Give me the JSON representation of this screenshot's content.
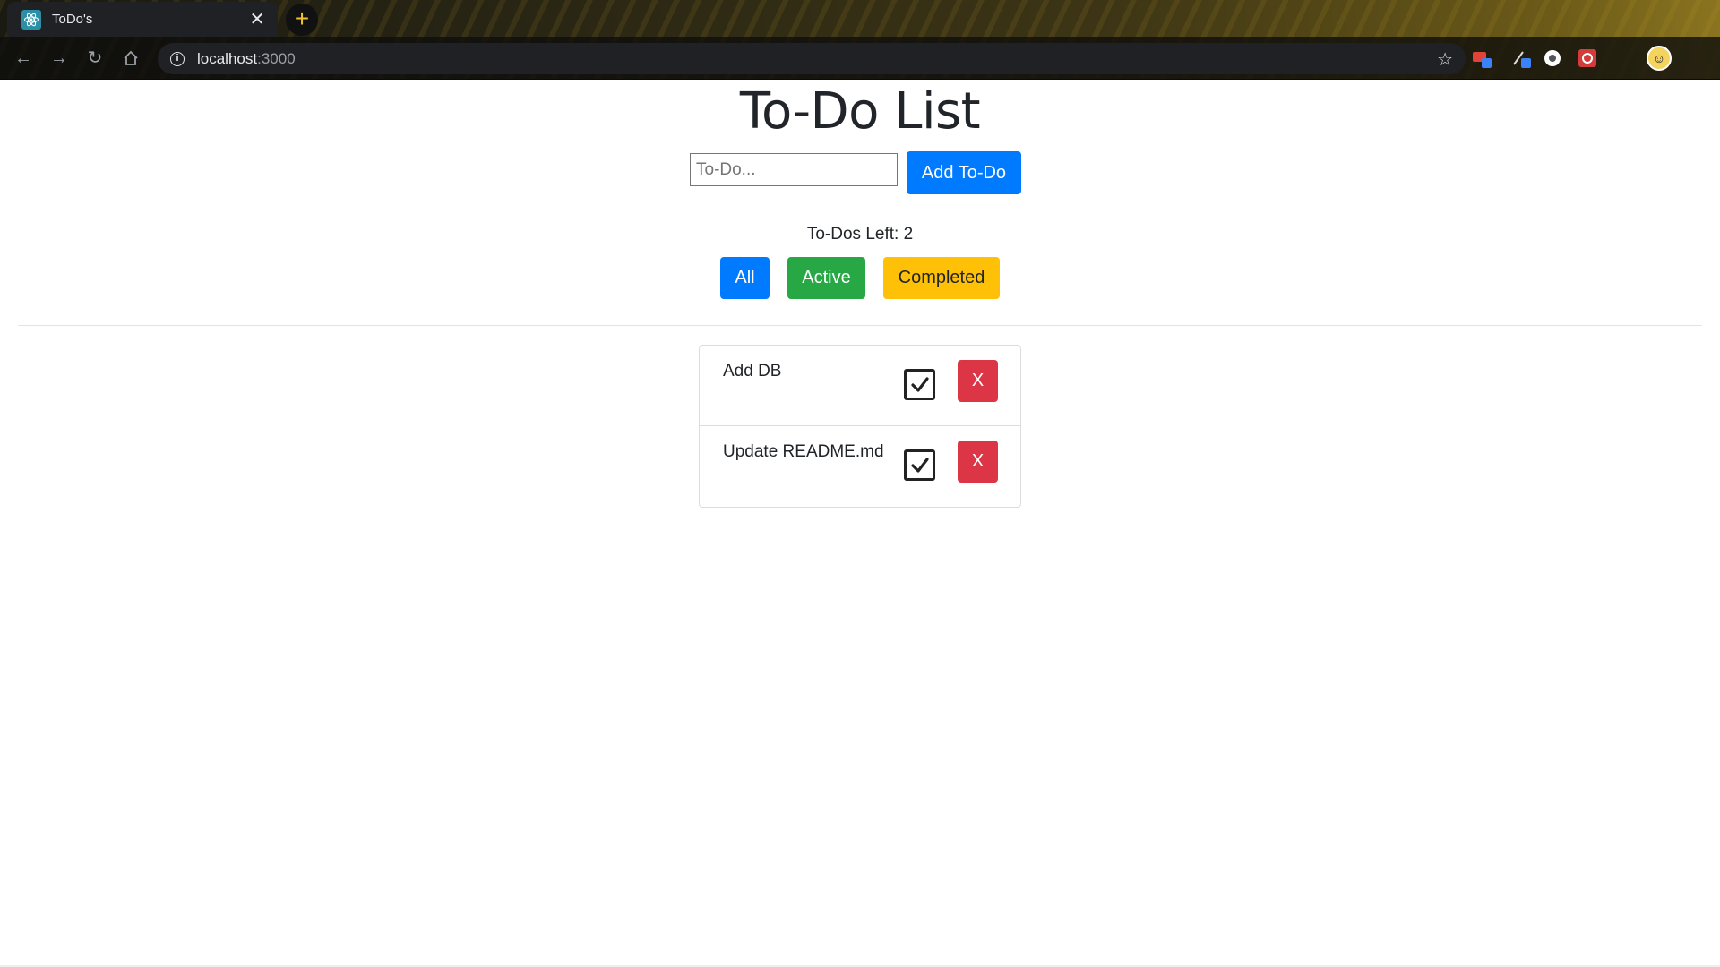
{
  "browser": {
    "tab_title": "ToDo's",
    "tab_close": "✕",
    "new_tab": "+",
    "url_host": "localhost",
    "url_port": ":3000"
  },
  "app": {
    "title": "To-Do List",
    "input_placeholder": "To-Do...",
    "input_value": "",
    "add_button": "Add To-Do",
    "todos_left_label": "To-Dos Left: 2",
    "filters": {
      "all": "All",
      "active": "Active",
      "completed": "Completed"
    },
    "todos": [
      {
        "text": "Add DB",
        "checked": true,
        "delete_label": "X"
      },
      {
        "text": "Update README.md",
        "checked": true,
        "delete_label": "X"
      }
    ]
  },
  "colors": {
    "primary": "#007bff",
    "success": "#28a745",
    "warning": "#ffc107",
    "danger": "#dc3545"
  }
}
